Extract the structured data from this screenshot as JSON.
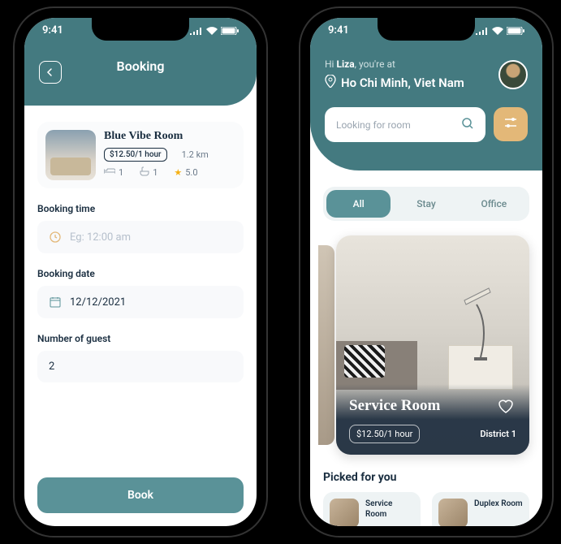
{
  "status": {
    "time": "9:41"
  },
  "booking": {
    "title": "Booking",
    "room": {
      "name": "Blue Vibe Room",
      "price": "$12.50/1 hour",
      "distance": "1.2 km",
      "beds": "1",
      "baths": "1",
      "rating": "5.0"
    },
    "form": {
      "time_label": "Booking time",
      "time_placeholder": "Eg: 12:00 am",
      "date_label": "Booking date",
      "date_value": "12/12/2021",
      "guest_label": "Number of guest",
      "guest_value": "2"
    },
    "cta": "Book"
  },
  "home": {
    "greeting_prefix": "Hi ",
    "greeting_name": "Liza",
    "greeting_suffix": ", you're at",
    "location": "Ho Chi Minh, Viet Nam",
    "search_placeholder": "Looking for room",
    "tabs": {
      "all": "All",
      "stay": "Stay",
      "office": "Office"
    },
    "feature": {
      "title": "Service Room",
      "price": "$12.50/1 hour",
      "location": "District 1"
    },
    "section_title": "Picked for you",
    "picks": [
      {
        "name": "Service Room"
      },
      {
        "name": "Duplex Room"
      }
    ]
  }
}
